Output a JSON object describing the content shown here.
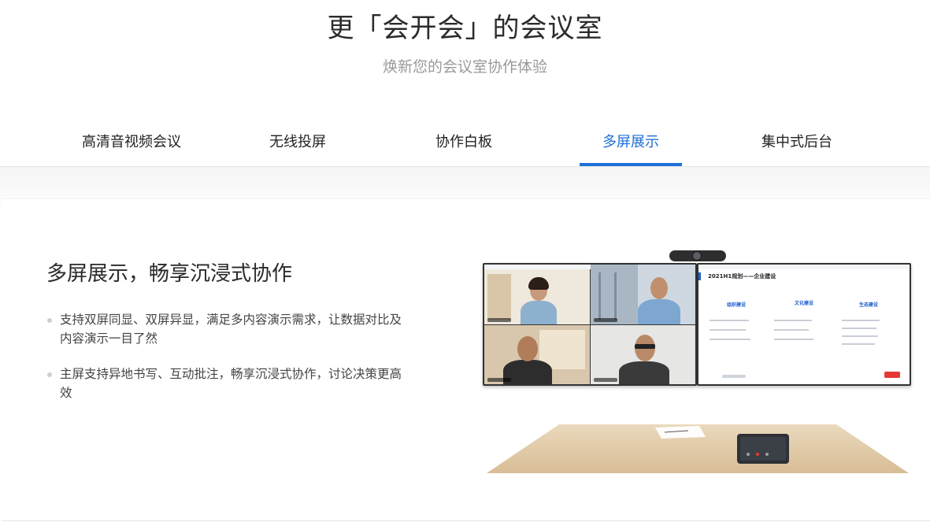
{
  "header": {
    "title": "更「会开会」的会议室",
    "subtitle": "焕新您的会议室协作体验"
  },
  "tabs": [
    {
      "label": "高清音视频会议",
      "active": false
    },
    {
      "label": "无线投屏",
      "active": false
    },
    {
      "label": "协作白板",
      "active": false
    },
    {
      "label": "多屏展示",
      "active": true
    },
    {
      "label": "集中式后台",
      "active": false
    }
  ],
  "feature": {
    "title": "多屏展示，畅享沉浸式协作",
    "bullets": [
      "支持双屏同显、双屏异显，满足多内容演示需求，让数据对比及内容演示一目了然",
      "主屏支持异地书写、互动批注，畅享沉浸式协作，讨论决策更高效"
    ]
  },
  "illustration": {
    "slide_title": "2021H1规划——企业建设",
    "columns": [
      "组织建设",
      "文化建设",
      "生态建设"
    ]
  },
  "colors": {
    "accent": "#1f6fd6",
    "slide_heading": "#1f5fd0",
    "end_button": "#e53935"
  }
}
